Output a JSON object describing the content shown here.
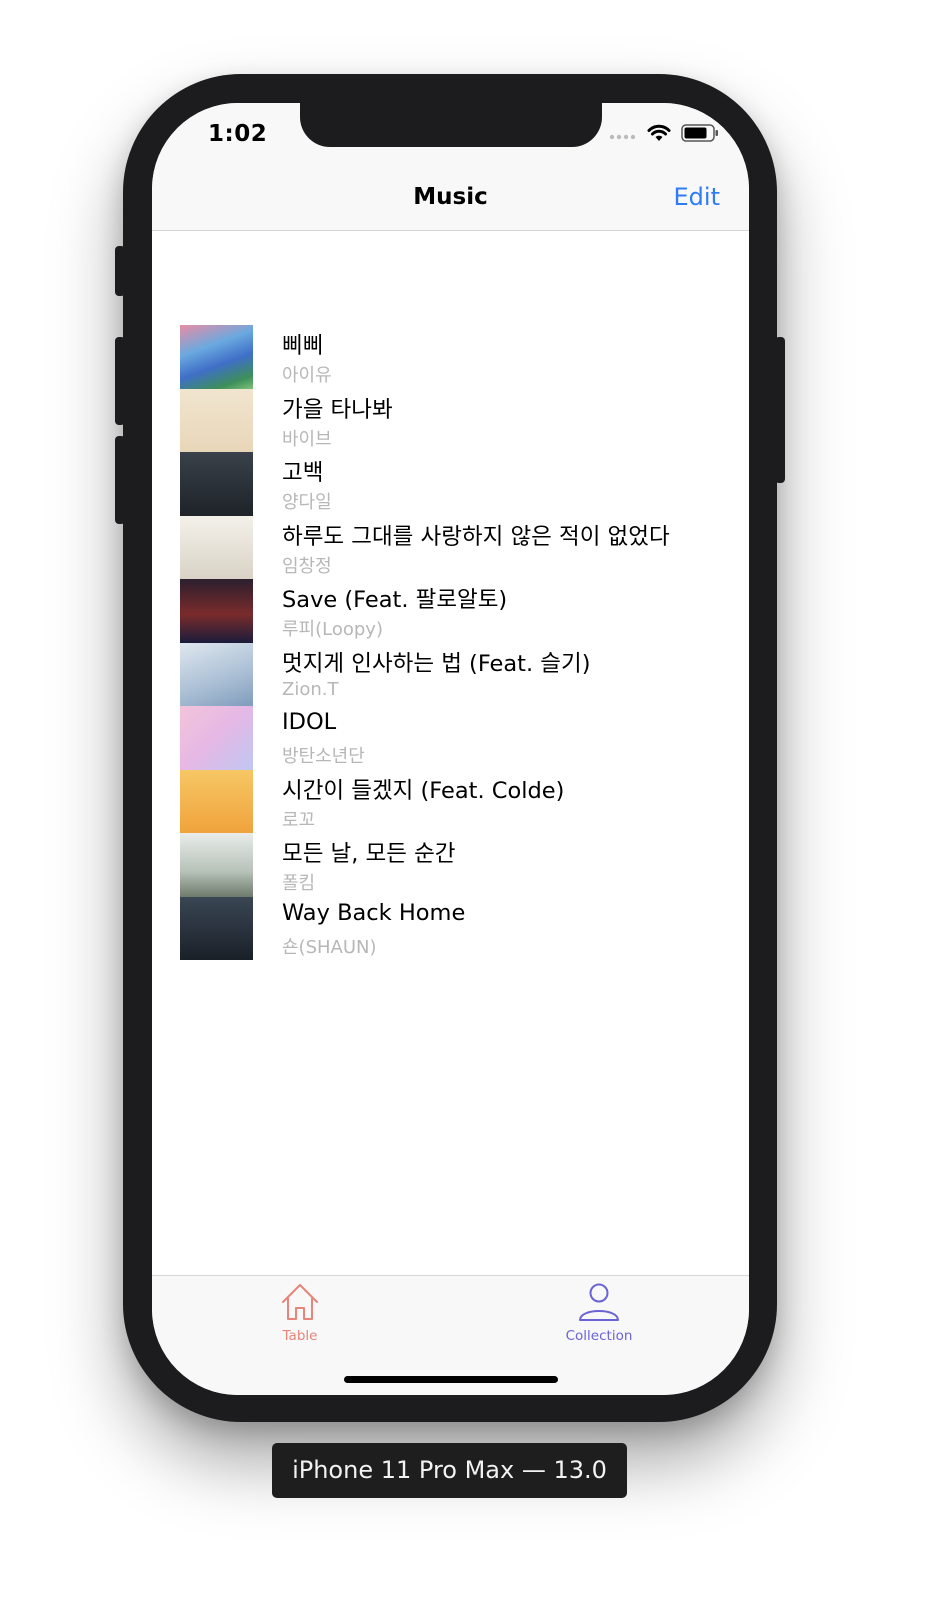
{
  "status_bar": {
    "time": "1:02",
    "icons": [
      "cellular-dots-icon",
      "wifi-icon",
      "battery-icon"
    ]
  },
  "nav": {
    "title": "Music",
    "edit_label": "Edit",
    "accent_color": "#2f7cf6"
  },
  "songs": [
    {
      "title": "삐삐",
      "artist": "아이유",
      "art": "album-art-icon"
    },
    {
      "title": "가을 타나봐",
      "artist": "바이브",
      "art": "album-art-icon"
    },
    {
      "title": "고백",
      "artist": "양다일",
      "art": "album-art-icon"
    },
    {
      "title": "하루도 그대를 사랑하지 않은 적이 없었다",
      "artist": "임창정",
      "art": "album-art-icon"
    },
    {
      "title": "Save (Feat. 팔로알토)",
      "artist": "루피(Loopy)",
      "art": "album-art-icon"
    },
    {
      "title": "멋지게 인사하는 법 (Feat. 슬기)",
      "artist": "Zion.T",
      "art": "album-art-icon"
    },
    {
      "title": "IDOL",
      "artist": "방탄소년단",
      "art": "album-art-icon"
    },
    {
      "title": "시간이 들겠지 (Feat. Colde)",
      "artist": "로꼬",
      "art": "album-art-icon"
    },
    {
      "title": "모든 날, 모든 순간",
      "artist": "폴킴",
      "art": "album-art-icon"
    },
    {
      "title": "Way Back Home",
      "artist": "숀(SHAUN)",
      "art": "album-art-icon"
    }
  ],
  "tabs": [
    {
      "label": "Table",
      "icon": "home-icon",
      "color": "#e8847a"
    },
    {
      "label": "Collection",
      "icon": "person-icon",
      "color": "#6a63d6"
    }
  ],
  "device_label": "iPhone 11 Pro Max — 13.0"
}
